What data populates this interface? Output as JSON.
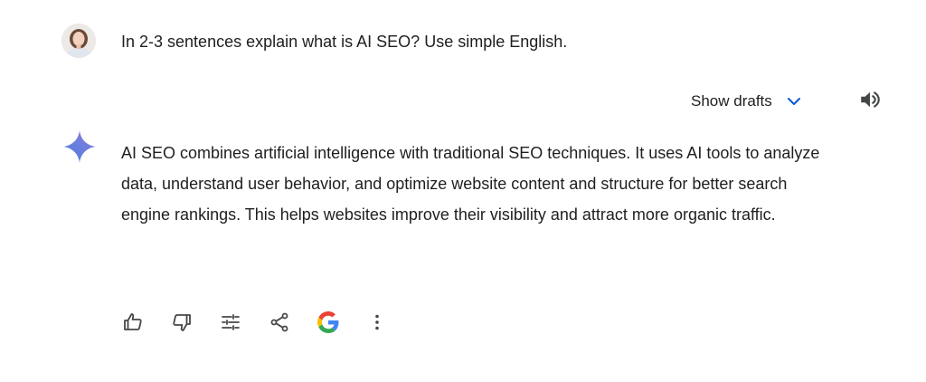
{
  "conversation": {
    "user_prompt": "In 2-3 sentences explain what is AI SEO? Use simple English.",
    "response_text": "AI SEO combines artificial intelligence with traditional SEO techniques. It uses AI tools to analyze data, understand user behavior, and optimize website content and structure for better search engine rankings. This helps websites improve their visibility and attract more organic traffic."
  },
  "header": {
    "show_drafts_label": "Show drafts",
    "chevron_icon": "chevron-down-icon",
    "speaker_icon": "speaker-icon"
  },
  "actions": [
    {
      "name": "thumbs-up",
      "icon": "thumbs-up-icon"
    },
    {
      "name": "thumbs-down",
      "icon": "thumbs-down-icon"
    },
    {
      "name": "modify-response",
      "icon": "tune-icon"
    },
    {
      "name": "share",
      "icon": "share-icon"
    },
    {
      "name": "double-check-response",
      "icon": "google-g-icon"
    },
    {
      "name": "more-options",
      "icon": "more-vert-icon"
    }
  ],
  "colors": {
    "text": "#1f1f1f",
    "accent_blue": "#0b57d0",
    "icon_gray": "#444746",
    "sparkle_blue": "#4a7bd9",
    "sparkle_purple": "#9b72cb",
    "google_blue": "#4285F4",
    "google_red": "#EA4335",
    "google_yellow": "#FBBC05",
    "google_green": "#34A853"
  }
}
